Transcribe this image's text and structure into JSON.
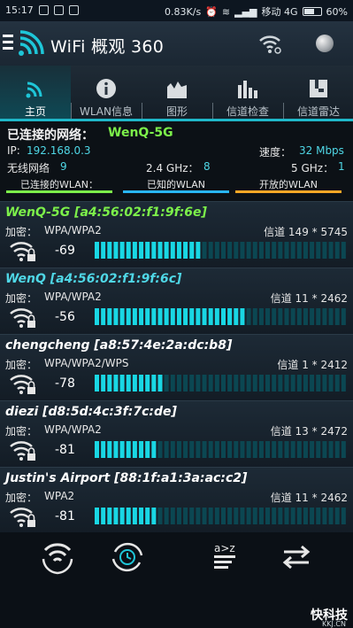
{
  "status": {
    "time": "15:17",
    "net_speed": "0.83K/s",
    "carrier": "移动 4G",
    "battery": "60%"
  },
  "app": {
    "title": "WiFi 概观 360"
  },
  "tabs": [
    {
      "label": "主页",
      "icon": "wifi-icon"
    },
    {
      "label": "WLAN信息",
      "icon": "info-icon"
    },
    {
      "label": "图形",
      "icon": "graph-icon"
    },
    {
      "label": "信道检查",
      "icon": "bars-icon"
    },
    {
      "label": "信道雷达",
      "icon": "radar-icon"
    }
  ],
  "summary": {
    "connected_label": "已连接的网络：",
    "connected_ssid": "WenQ-5G",
    "ip_label": "IP:",
    "ip_value": "192.168.0.3",
    "speed_label": "速度：",
    "speed_value": "32 Mbps",
    "networks_label": "无线网络",
    "networks_value": "9",
    "g24_label": "2.4 GHz：",
    "g24_value": "8",
    "g5_label": "5 GHz：",
    "g5_value": "1",
    "legend": [
      {
        "label": "已连接的WLAN：",
        "color": "#7cf04a"
      },
      {
        "label": "已知的WLAN",
        "color": "#29b6f6"
      },
      {
        "label": "开放的WLAN",
        "color": "#ffa726"
      }
    ]
  },
  "networks": [
    {
      "ssid": "WenQ-5G [a4:56:02:f1:9f:6e]",
      "type": "connected",
      "enc_label": "加密：",
      "enc": "WPA/WPA2",
      "channel": "信道 149 * 5745",
      "rssi": "-69",
      "level": 0.42
    },
    {
      "ssid": "WenQ [a4:56:02:f1:9f:6c]",
      "type": "known",
      "enc_label": "加密：",
      "enc": "WPA/WPA2",
      "channel": "信道 11 * 2462",
      "rssi": "-56",
      "level": 0.59
    },
    {
      "ssid": "chengcheng [a8:57:4e:2a:dc:b8]",
      "type": "other",
      "enc_label": "加密：",
      "enc": "WPA/WPA2/WPS",
      "channel": "信道 1 * 2412",
      "rssi": "-78",
      "level": 0.28
    },
    {
      "ssid": "diezi [d8:5d:4c:3f:7c:de]",
      "type": "other",
      "enc_label": "加密：",
      "enc": "WPA/WPA2",
      "channel": "信道 13 * 2472",
      "rssi": "-81",
      "level": 0.25
    },
    {
      "ssid": "Justin's Airport [88:1f:a1:3a:ac:c2]",
      "type": "other",
      "enc_label": "加密：",
      "enc": "WPA2",
      "channel": "信道 11 * 2462",
      "rssi": "-81",
      "level": 0.25
    }
  ],
  "toolbar": [
    {
      "name": "refresh-wifi-button",
      "icon": "wifi-refresh-icon"
    },
    {
      "name": "auto-refresh-button",
      "icon": "timer-refresh-icon"
    },
    {
      "name": "sort-button",
      "icon": "sort-az-icon"
    },
    {
      "name": "switch-button",
      "icon": "swap-arrows-icon"
    }
  ],
  "watermark": {
    "text": "快科技",
    "sub": "KKJ.CN"
  }
}
